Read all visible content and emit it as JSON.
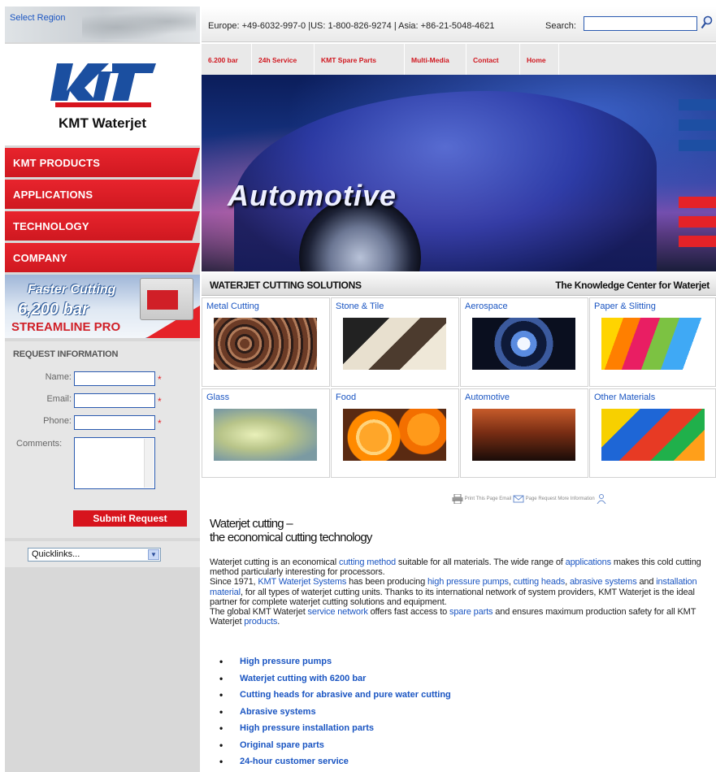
{
  "region": {
    "label": "Select Region"
  },
  "logo": {
    "name": "KMT Waterjet"
  },
  "main_nav": [
    "KMT PRODUCTS",
    "APPLICATIONS",
    "TECHNOLOGY",
    "COMPANY"
  ],
  "promo": {
    "line1": "Faster Cutting",
    "line2": "6,200 bar",
    "line3": "STREAMLINE PRO"
  },
  "request": {
    "title": "REQUEST INFORMATION",
    "name_label": "Name:",
    "email_label": "Email:",
    "phone_label": "Phone:",
    "comments_label": "Comments:",
    "required_marker": "*",
    "submit_label": "Submit Request"
  },
  "quicklinks": {
    "selected": "Quicklinks..."
  },
  "header": {
    "contact": "Europe: +49-6032-997-0 |US: 1-800-826-9274 | Asia: +86-21-5048-4621",
    "search_label": "Search:"
  },
  "sub_nav": [
    "6.200 bar",
    "24h Service",
    "KMT Spare Parts",
    "Multi-Media",
    "Contact",
    "Home"
  ],
  "hero": {
    "title": "Automotive"
  },
  "solutions": {
    "title": "WATERJET CUTTING SOLUTIONS",
    "knowledge_title": "The Knowledge Center for Waterjet",
    "tiles": [
      "Metal Cutting",
      "Stone & Tile",
      "Aerospace",
      "Paper & Slitting",
      "Glass",
      "Food",
      "Automotive",
      "Other Materials"
    ]
  },
  "utility": {
    "print": "Print This Page",
    "email": "Email",
    "page": "Page",
    "request": "Request More Information"
  },
  "article": {
    "heading_line1": "Waterjet cutting –",
    "heading_line2": "the economical cutting technology",
    "p1_a": "Waterjet cutting is an economical ",
    "p1_link1": "cutting method",
    "p1_b": " suitable for all materials. The wide range of ",
    "p1_link2": "applications",
    "p1_c": "  makes this cold cutting method particularly interesting for processors.",
    "p2_a": "Since 1971, ",
    "p2_link1": "KMT Waterjet Systems",
    "p2_b": " has been producing ",
    "p2_link2": "high pressure pumps",
    "p2_c": ", ",
    "p2_link3": "cutting heads",
    "p2_d": ", ",
    "p2_link4": "abrasive systems",
    "p2_e": " and ",
    "p2_link5": "installation material",
    "p2_f": ", for all types of waterjet cutting units. Thanks to its international network of system providers, KMT Waterjet is the ideal partner for complete waterjet cutting solutions and equipment.",
    "p3_a": "The global KMT Waterjet ",
    "p3_link1": "service network",
    "p3_b": " offers fast access to ",
    "p3_link2": "spare parts",
    "p3_c": " and ensures maximum production safety for all KMT Waterjet ",
    "p3_link3": "products",
    "p3_d": "."
  },
  "bullets": [
    "High pressure pumps",
    "Waterjet cutting with 6200 bar",
    "Cutting heads for abrasive and pure water cutting",
    "Abrasive systems",
    "High pressure installation parts",
    "Original spare parts",
    "24-hour customer service"
  ],
  "colors": {
    "brand_red": "#d7141d",
    "link_blue": "#1a55c2",
    "logo_blue": "#1b4fa0"
  },
  "icons": {
    "search": "magnifier-icon",
    "print": "printer-icon",
    "email": "envelope-icon",
    "request": "info-person-icon"
  }
}
